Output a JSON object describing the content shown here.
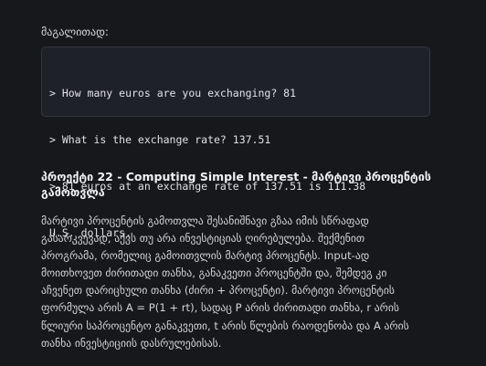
{
  "intro_label": "მაგალითად:",
  "code_lines": [
    "> How many euros are you exchanging? 81",
    "> What is the exchange rate? 137.51",
    "> 81 euros at an exchange rate of 137.51 is 111.38",
    "U.S. dollars."
  ],
  "heading_lines": [
    "პროექტი 22 - Computing Simple Interest - მარტივი პროცენტის",
    "გამოთვლა"
  ],
  "body_lines": [
    "მარტივი პროცენტის გამოთვლა შესანიშნავი გზაა იმის სწრაფად",
    "გასარკვევად, აქვს თუ არა ინვესტიციას ღირებულება. შექმენით",
    "პროგრამა, რომელიც გამოითვლის მარტივ პროცენტს. Input-ად",
    "მოითხოვეთ ძირითადი თანხა, განაკვეთი პროცენტში და, შემდეგ კი",
    "აჩვენეთ დარიცხული თანხა (ძირი + პროცენტი). მარტივი პროცენტის",
    "ფორმულა არის A = P(1 + rt), სადაც P არის ძირითადი თანხა, r არის",
    "წლიური საპროცენტო განაკვეთი, t არის წლების რაოდენობა და A არის",
    "თანხა ინვესტიციის დასრულებისას."
  ]
}
